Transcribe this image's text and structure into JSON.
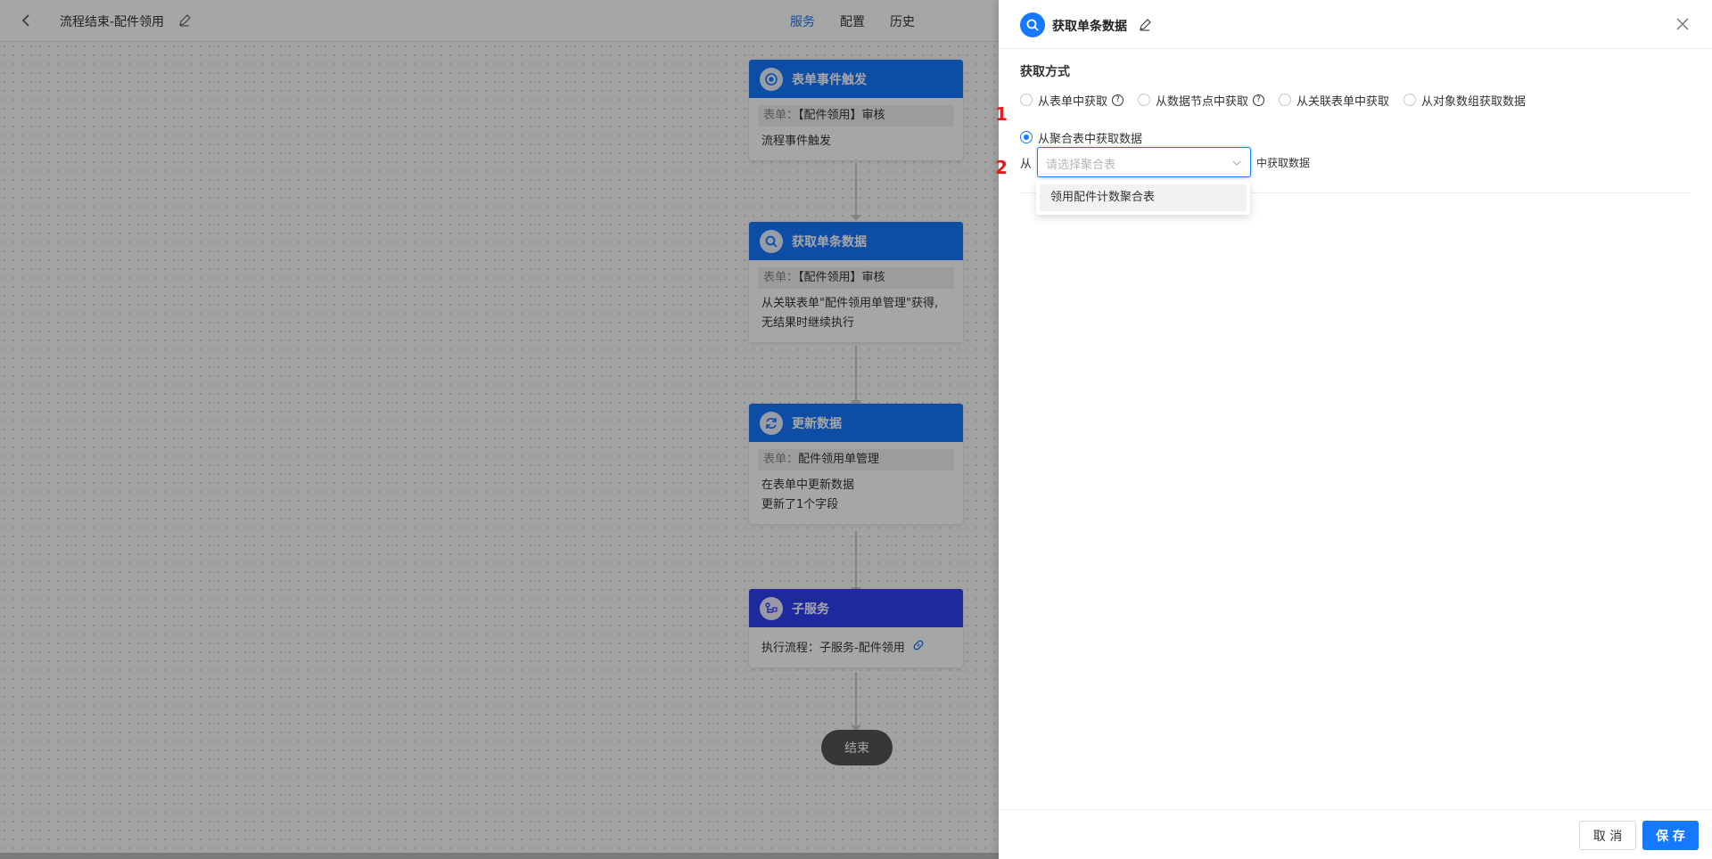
{
  "topbar": {
    "title": "流程结束-配件领用",
    "tabs": [
      {
        "label": "服务",
        "active": true
      },
      {
        "label": "配置",
        "active": false
      },
      {
        "label": "历史",
        "active": false
      }
    ]
  },
  "nodes": [
    {
      "title": "表单事件触发",
      "icon": "target-icon",
      "pill_key": "表单：",
      "pill_value": "【配件领用】审核",
      "lines": [
        "流程事件触发"
      ]
    },
    {
      "title": "获取单条数据",
      "icon": "search-icon",
      "pill_key": "表单：",
      "pill_value": "【配件领用】审核",
      "lines": [
        "从关联表单\"配件领用单管理\"获得,",
        "无结果时继续执行"
      ]
    },
    {
      "title": "更新数据",
      "icon": "refresh-icon",
      "pill_key": "表单：",
      "pill_value": "配件领用单管理",
      "lines": [
        "在表单中更新数据",
        "更新了1个字段"
      ]
    },
    {
      "title": "子服务",
      "icon": "subflow-icon",
      "line": "执行流程：子服务-配件领用"
    }
  ],
  "end_label": "结束",
  "drawer": {
    "title": "获取单条数据",
    "section_label": "获取方式",
    "radio_options": [
      {
        "label": "从表单中获取",
        "help": true,
        "selected": false
      },
      {
        "label": "从数据节点中获取",
        "help": true,
        "selected": false
      },
      {
        "label": "从关联表单中获取",
        "help": false,
        "selected": false
      },
      {
        "label": "从对象数组获取数据",
        "help": false,
        "selected": false
      },
      {
        "label": "从聚合表中获取数据",
        "help": false,
        "selected": true
      }
    ],
    "annotation_1": "1",
    "annotation_2": "2",
    "from_label": "从",
    "select_placeholder": "请选择聚合表",
    "from_tail": "中获取数据",
    "dropdown_options": [
      "领用配件计数聚合表"
    ],
    "cancel_label": "取 消",
    "save_label": "保 存"
  },
  "colors": {
    "primary": "#1677ff",
    "subflow_header": "#2f3ff2",
    "annotation": "#e41e1e"
  }
}
